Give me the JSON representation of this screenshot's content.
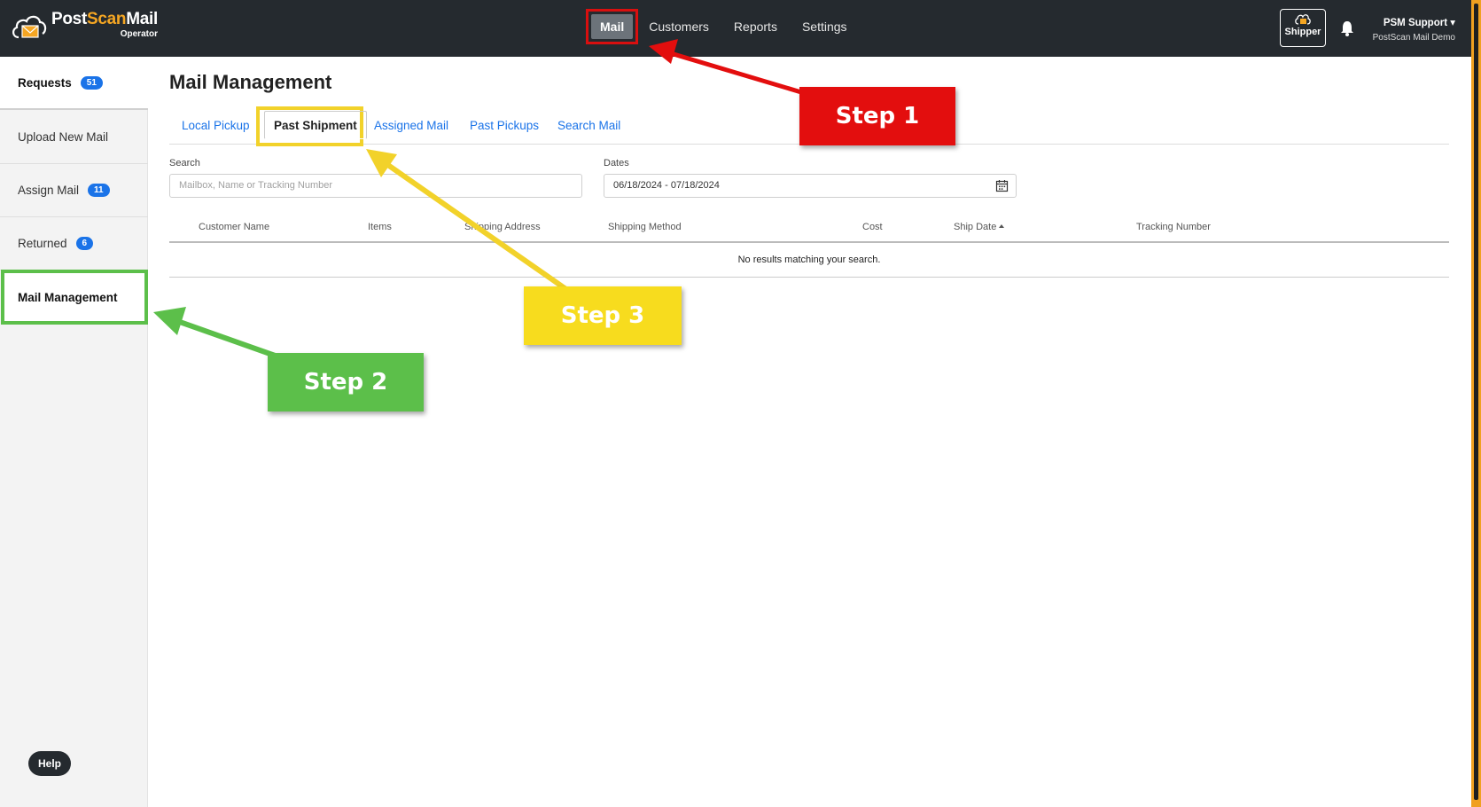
{
  "brand": {
    "name_part1": "Post",
    "name_part2": "Scan",
    "name_part3": "Mail",
    "subtitle": "Operator"
  },
  "top_nav": {
    "mail": "Mail",
    "customers": "Customers",
    "reports": "Reports",
    "settings": "Settings"
  },
  "header_right": {
    "shipper_label": "Shipper",
    "user_name": "PSM Support",
    "user_org": "PostScan Mail Demo"
  },
  "sidebar": {
    "items": [
      {
        "label": "Requests",
        "badge": "51"
      },
      {
        "label": "Upload New Mail",
        "badge": ""
      },
      {
        "label": "Assign Mail",
        "badge": "11"
      },
      {
        "label": "Returned",
        "badge": "6"
      },
      {
        "label": "Mail Management",
        "badge": ""
      }
    ],
    "help": "Help"
  },
  "main": {
    "title": "Mail Management",
    "tabs": [
      "Local Pickup",
      "Past Shipment",
      "Assigned Mail",
      "Past Pickups",
      "Search Mail"
    ],
    "active_tab": "Past Shipment",
    "search": {
      "label": "Search",
      "placeholder": "Mailbox, Name or Tracking Number",
      "value": ""
    },
    "dates": {
      "label": "Dates",
      "value": "06/18/2024 - 07/18/2024"
    },
    "table": {
      "columns": [
        "Customer Name",
        "Items",
        "Shipping Address",
        "Shipping Method",
        "Cost",
        "Ship Date",
        "Tracking Number"
      ],
      "sorted_column": "Ship Date",
      "empty_message": "No results matching your search."
    }
  },
  "annotations": {
    "step1": "Step 1",
    "step2": "Step 2",
    "step3": "Step 3"
  },
  "colors": {
    "navbar": "#252a2f",
    "link": "#1a73e8",
    "badge": "#1a73e8",
    "step1": "#e30e0e",
    "step2": "#5cbf4a",
    "step3": "#f7dc1e",
    "brand_accent": "#f5a623"
  }
}
